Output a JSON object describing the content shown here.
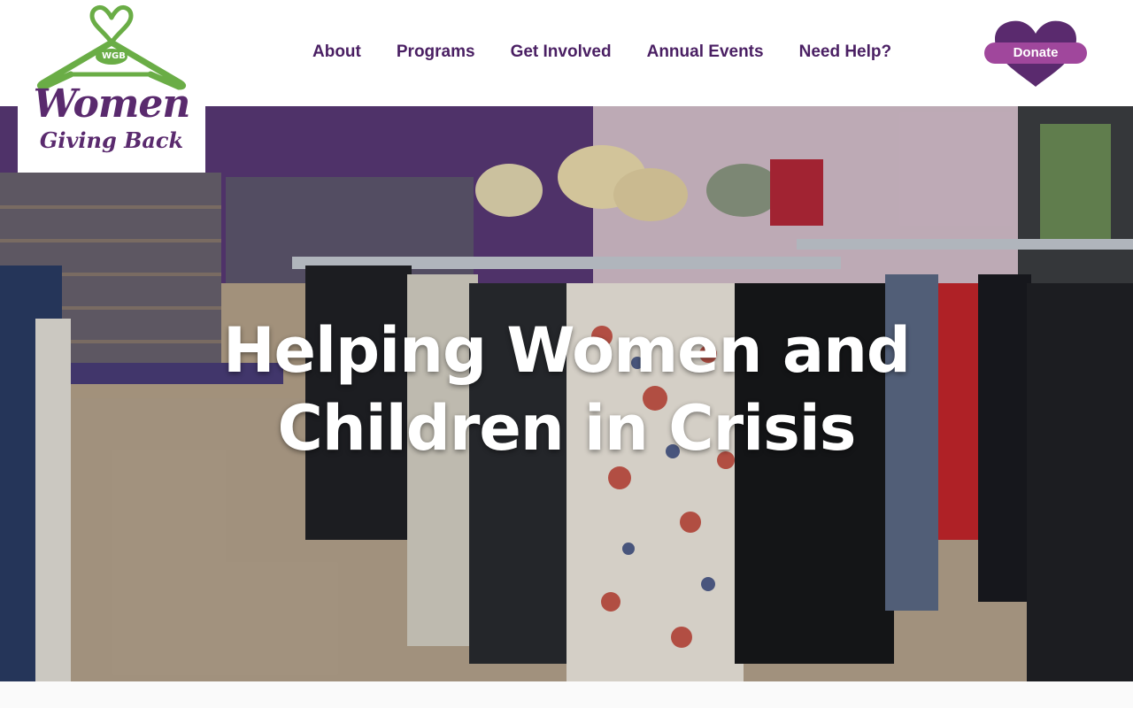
{
  "logo": {
    "badge": "WGB",
    "line1": "Women",
    "line2": "Giving Back",
    "icon": "hanger-heart-icon"
  },
  "nav": {
    "items": [
      {
        "label": "About"
      },
      {
        "label": "Programs"
      },
      {
        "label": "Get Involved"
      },
      {
        "label": "Annual Events"
      },
      {
        "label": "Need Help?"
      }
    ]
  },
  "donate": {
    "label": "Donate",
    "icon": "heart-icon"
  },
  "hero": {
    "title_line1": "Helping Women and",
    "title_line2": "Children in Crisis"
  },
  "colors": {
    "brand_purple": "#4a1f63",
    "logo_purple": "#5a2a6e",
    "donate_heart": "#5a2a6e",
    "donate_pill": "#a0479c",
    "hanger_green": "#6aad46"
  }
}
